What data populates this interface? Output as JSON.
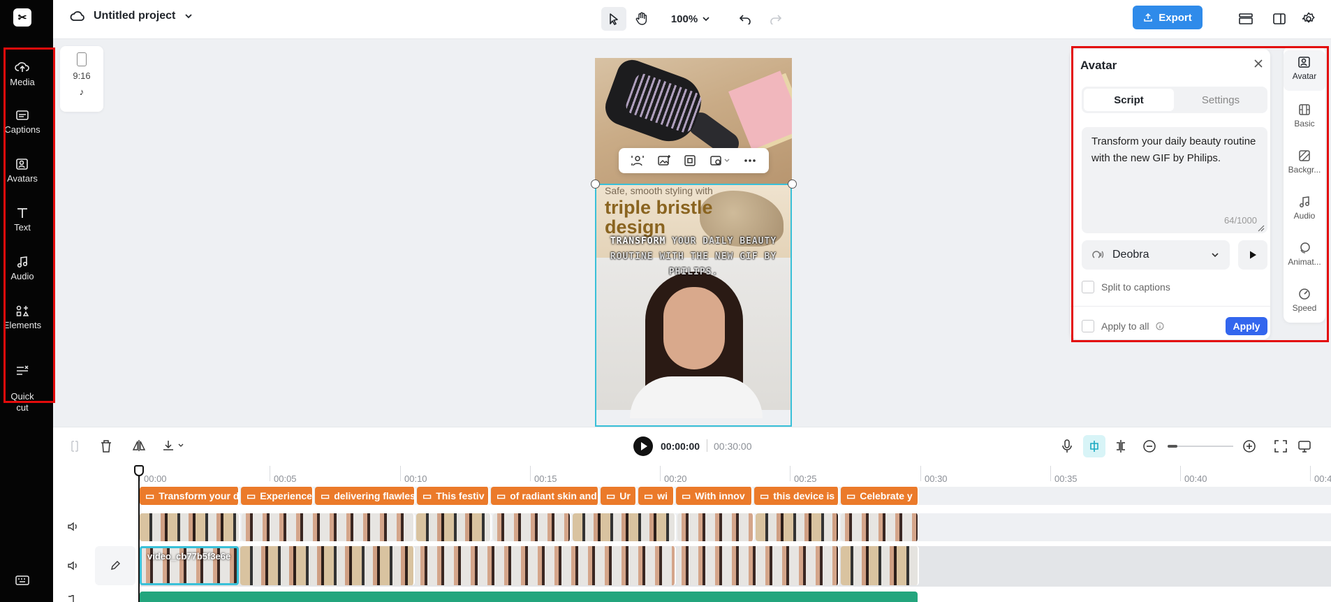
{
  "project": {
    "title": "Untitled project"
  },
  "topbar": {
    "zoom": "100%",
    "export_label": "Export"
  },
  "sidebar": {
    "items": [
      {
        "label": "Media",
        "icon": "cloud-upload-icon"
      },
      {
        "label": "Captions",
        "icon": "captions-icon"
      },
      {
        "label": "Avatars",
        "icon": "avatar-icon"
      },
      {
        "label": "Text",
        "icon": "text-icon"
      },
      {
        "label": "Audio",
        "icon": "music-note-icon"
      },
      {
        "label": "Elements",
        "icon": "elements-icon"
      },
      {
        "label": "Quick\ncut",
        "icon": "quick-cut-icon"
      }
    ]
  },
  "canvas": {
    "ratio_label": "9:16",
    "subtitle_small": "Safe, smooth styling with",
    "headline": "triple bristle design",
    "caption_highlight": "TRANSFORM",
    "caption_rest": "YOUR DAILY BEAUTY ROUTINE WITH THE NEW GIF BY PHILIPS."
  },
  "avatar_panel": {
    "title": "Avatar",
    "tabs": {
      "script": "Script",
      "settings": "Settings"
    },
    "script_text": "Transform your daily beauty routine with the new GIF by Philips.",
    "char_count": "64/1000",
    "voice_name": "Deobra",
    "split_to_captions": "Split to captions",
    "apply_to_all": "Apply to all",
    "apply_label": "Apply"
  },
  "right_tabs": [
    {
      "label": "Avatar",
      "icon": "avatar-icon"
    },
    {
      "label": "Basic",
      "icon": "film-icon"
    },
    {
      "label": "Backgr...",
      "icon": "background-icon"
    },
    {
      "label": "Audio",
      "icon": "music-note-icon"
    },
    {
      "label": "Animat...",
      "icon": "animation-icon"
    },
    {
      "label": "Speed",
      "icon": "speed-icon"
    }
  ],
  "timeline": {
    "current_time": "00:00:00",
    "total_time": "00:30:00",
    "ruler": [
      "00:00",
      "00:05",
      "00:10",
      "00:15",
      "00:20",
      "00:25",
      "00:30",
      "00:35",
      "00:40",
      "00:4"
    ],
    "caption_clips": [
      "Transform your d",
      "Experience",
      "delivering flawles",
      "This festiv",
      "of radiant skin and",
      "Ur",
      "wi",
      "With innov",
      "this device is",
      "Celebrate y"
    ],
    "selected_clip_name": "video_cb77b5f3e6e"
  },
  "colors": {
    "accent": "#2f8bea",
    "caption_clip": "#eb7a2a",
    "audio_track": "#23a57d",
    "selection": "#39c0d8",
    "highlight_box": "#e30b0b"
  }
}
